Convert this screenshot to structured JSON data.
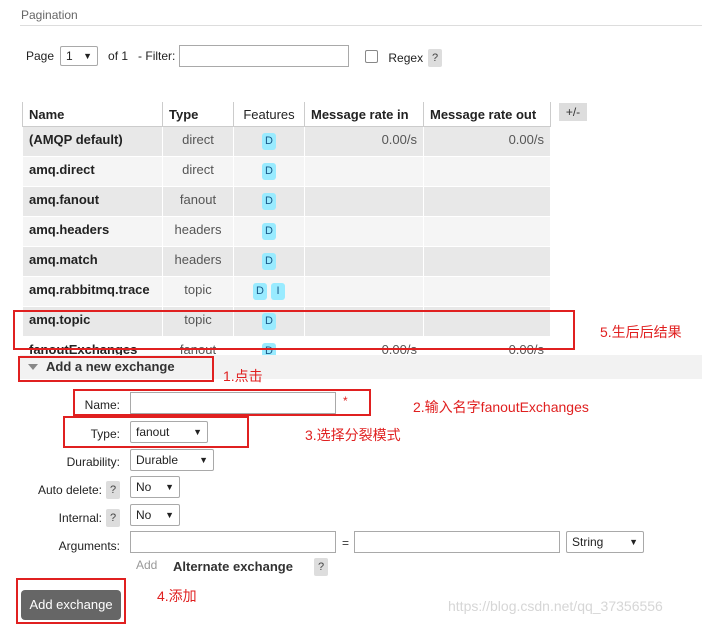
{
  "section": {
    "title": "Pagination"
  },
  "pagination": {
    "page_label": "Page",
    "page_value": "1",
    "of_label": "of 1",
    "filter_label": "- Filter:",
    "filter_value": "",
    "regex_label": "Regex",
    "help": "?"
  },
  "table": {
    "headers": [
      "Name",
      "Type",
      "Features",
      "Message rate in",
      "Message rate out"
    ],
    "plusminus": "+/-",
    "rows": [
      {
        "name": "(AMQP default)",
        "type": "direct",
        "features": [
          "D"
        ],
        "rate_in": "0.00/s",
        "rate_out": "0.00/s"
      },
      {
        "name": "amq.direct",
        "type": "direct",
        "features": [
          "D"
        ],
        "rate_in": "",
        "rate_out": ""
      },
      {
        "name": "amq.fanout",
        "type": "fanout",
        "features": [
          "D"
        ],
        "rate_in": "",
        "rate_out": ""
      },
      {
        "name": "amq.headers",
        "type": "headers",
        "features": [
          "D"
        ],
        "rate_in": "",
        "rate_out": ""
      },
      {
        "name": "amq.match",
        "type": "headers",
        "features": [
          "D"
        ],
        "rate_in": "",
        "rate_out": ""
      },
      {
        "name": "amq.rabbitmq.trace",
        "type": "topic",
        "features": [
          "D",
          "I"
        ],
        "rate_in": "",
        "rate_out": ""
      },
      {
        "name": "amq.topic",
        "type": "topic",
        "features": [
          "D"
        ],
        "rate_in": "",
        "rate_out": ""
      },
      {
        "name": "fanoutExchanges",
        "type": "fanout",
        "features": [
          "D"
        ],
        "rate_in": "0.00/s",
        "rate_out": "0.00/s"
      }
    ]
  },
  "add_exchange": {
    "title": "Add a new exchange",
    "name_label": "Name:",
    "name_value": "",
    "required_mark": "*",
    "type_label": "Type:",
    "type_value": "fanout",
    "durability_label": "Durability:",
    "durability_value": "Durable",
    "auto_delete_label": "Auto delete:",
    "auto_delete_value": "No",
    "internal_label": "Internal:",
    "internal_value": "No",
    "arguments_label": "Arguments:",
    "arg_key": "",
    "equals": "=",
    "arg_value": "",
    "arg_type": "String",
    "add_link": "Add",
    "alternate_label": "Alternate exchange",
    "help": "?",
    "button_label": "Add exchange"
  },
  "annotations": {
    "n1": "1.点击",
    "n2": "2.输入名字fanoutExchanges",
    "n3": "3.选择分裂模式",
    "n4": "4.添加",
    "n5": "5.生后后结果"
  },
  "watermark": "https://blog.csdn.net/qq_37356556",
  "colors": {
    "annotation": "#e02020",
    "badge": "#99ebff",
    "button": "#666666"
  }
}
